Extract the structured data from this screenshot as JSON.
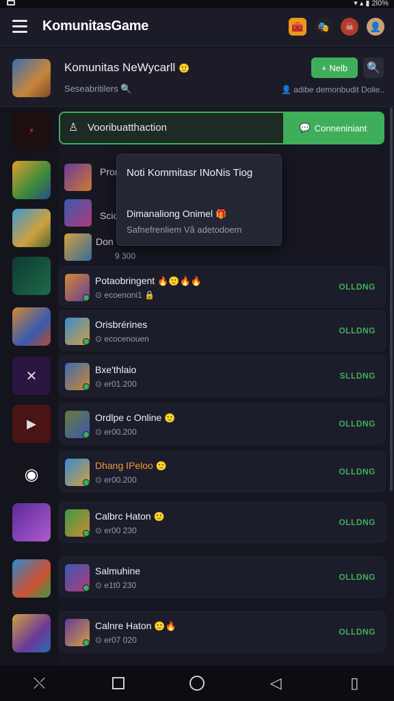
{
  "appbar": {
    "title": "KomunitasGame",
    "icons": [
      "menu-icon",
      "chest-icon",
      "mask-icon",
      "pirate-avatar-icon",
      "user-avatar-icon"
    ]
  },
  "header": {
    "title": "Komunitas NeWycarll",
    "title_emoji": "🙂",
    "subtitle": "Seseabritilers",
    "meta": "adibe demonbudit Dolie..",
    "new_label": "Nelb",
    "new_icon": "+"
  },
  "search": {
    "text": "Vooribuatthaction",
    "button_label": "Conneniniant"
  },
  "popup": {
    "title": "Noti Kommitasr INoNis Tiog",
    "line1": "Dimanaliong Onimel",
    "line1_emoji": "🎁",
    "line2": "Safnefrenliem Vå adetodoem"
  },
  "partial_rows": [
    {
      "title": "Pror"
    },
    {
      "title": "Scio"
    },
    {
      "title": "Don",
      "sub": "9 300"
    }
  ],
  "rows": [
    {
      "title": "Potaobringent",
      "title_emoji": "🔥🙂🔥🔥",
      "sub": "ecoenoni1",
      "sub_emoji": "🔒",
      "status": "OLLDNG"
    },
    {
      "title": "Orisbrérines",
      "title_emoji": "",
      "sub": "ecocenouen",
      "sub_emoji": "",
      "status": "OLLDNG"
    },
    {
      "title": "Bxe'thlaio",
      "title_emoji": "",
      "sub": "er01.200",
      "sub_emoji": "",
      "status": "SLLDNG"
    },
    {
      "title": "Ordlpe c Online",
      "title_emoji": "🙂",
      "sub": "er00.200",
      "sub_emoji": "",
      "status": "OLLDNG"
    },
    {
      "title": "Dhang IPeloo",
      "title_emoji": "🙂",
      "sub": "er00.200",
      "sub_emoji": "",
      "status": "OLLDNG"
    },
    {
      "title": "Calbrc Haton",
      "title_emoji": "🙂",
      "sub": "er00 230",
      "sub_emoji": "",
      "status": "OLLDNG"
    },
    {
      "title": "Salmuhine",
      "title_emoji": "",
      "sub": "e1t0 230",
      "sub_emoji": "",
      "status": "OLLDNG"
    },
    {
      "title": "Calnre Haton",
      "title_emoji": "🙂🔥",
      "sub": "er07 020",
      "sub_emoji": "",
      "status": "OLLDNG"
    }
  ]
}
